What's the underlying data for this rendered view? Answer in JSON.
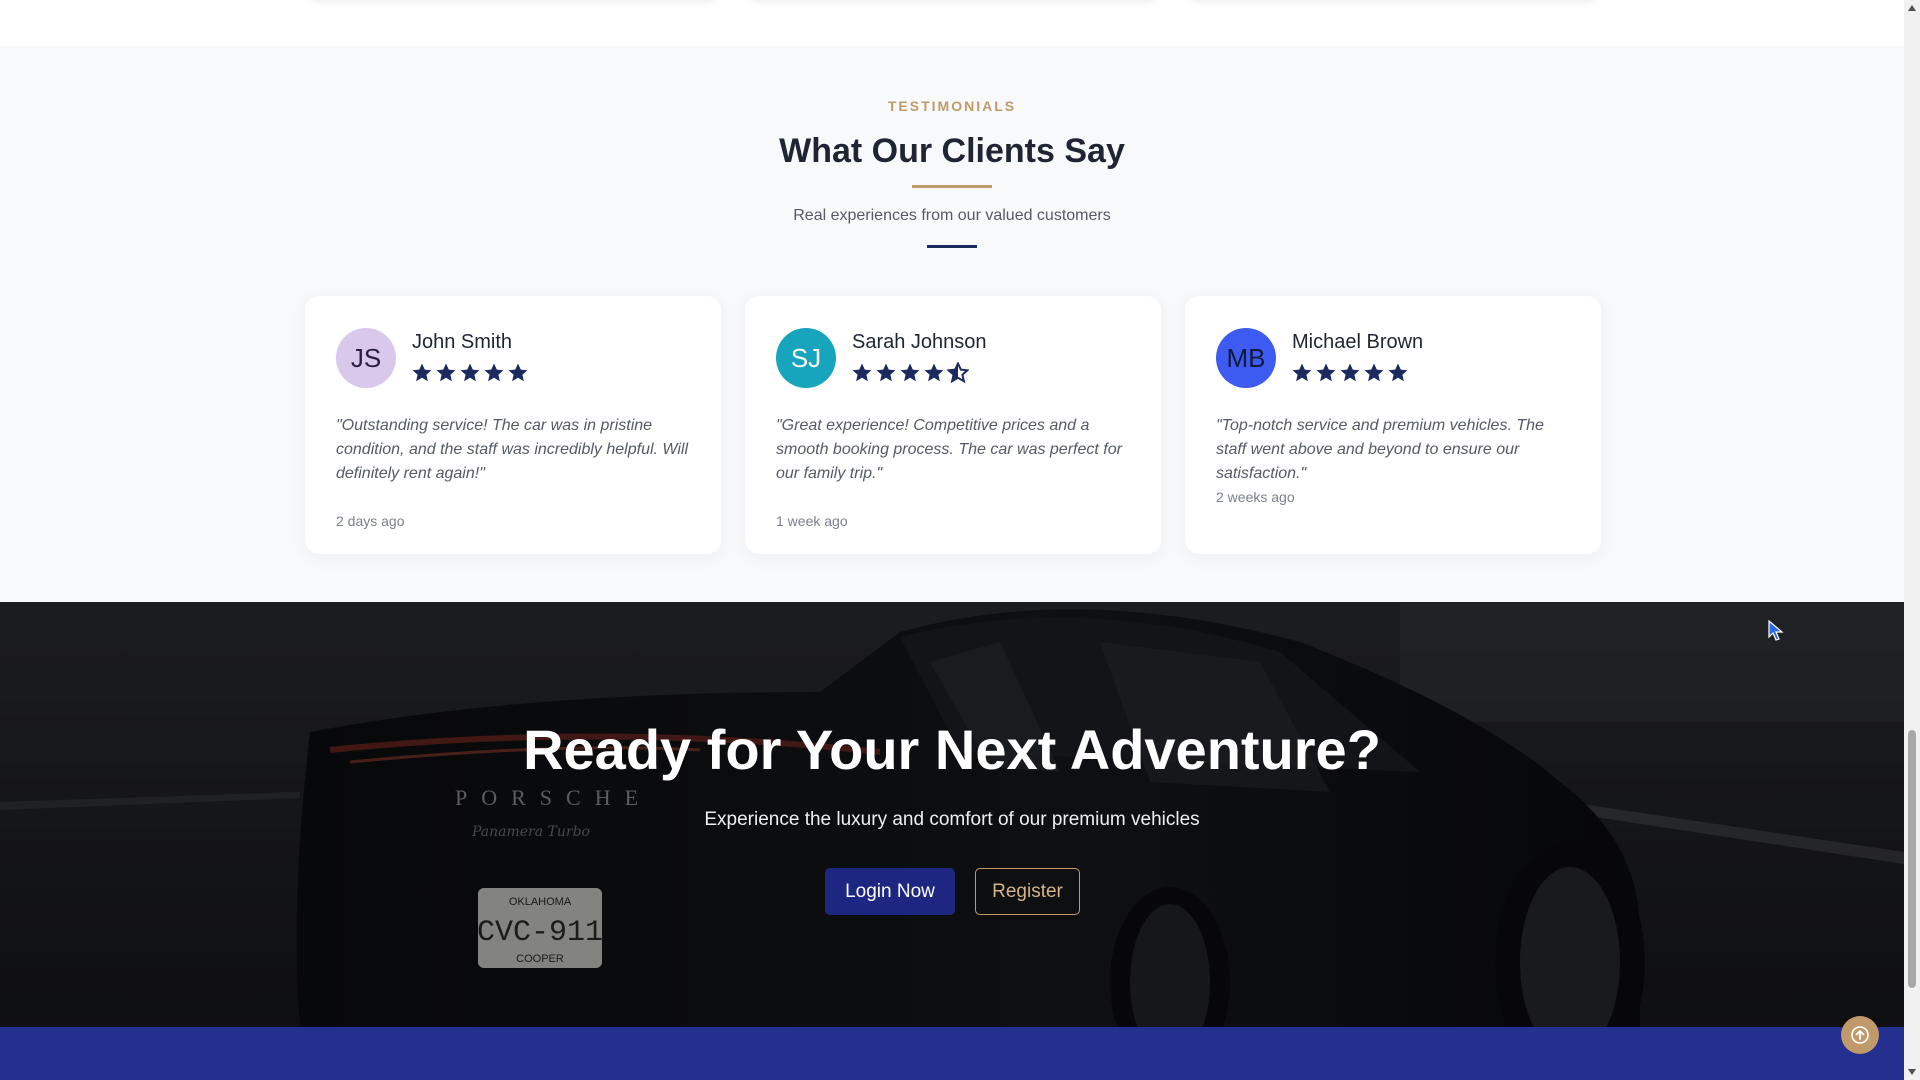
{
  "testimonials": {
    "eyebrow": "TESTIMONIALS",
    "title": "What Our Clients Say",
    "subtitle": "Real experiences from our valued customers",
    "cards": [
      {
        "initials": "JS",
        "name": "John Smith",
        "rating": 5,
        "quote": "\"Outstanding service! The car was in pristine condition, and the staff was incredibly helpful. Will definitely rent again!\"",
        "time": "2 days ago",
        "avatar_bg": "#d9c8ec",
        "avatar_fg": "#2a2040"
      },
      {
        "initials": "SJ",
        "name": "Sarah Johnson",
        "rating": 4.5,
        "quote": "\"Great experience! Competitive prices and a smooth booking process. The car was perfect for our family trip.\"",
        "time": "1 week ago",
        "avatar_bg": "#17a5bd",
        "avatar_fg": "#ffffff"
      },
      {
        "initials": "MB",
        "name": "Michael Brown",
        "rating": 5,
        "quote": "\"Top-notch service and premium vehicles. The staff went above and beyond to ensure our satisfaction.\"",
        "time": "2 weeks ago",
        "avatar_bg": "#3d5af1",
        "avatar_fg": "#111a3a"
      }
    ]
  },
  "cta": {
    "title": "Ready for Your Next Adventure?",
    "subtitle": "Experience the luxury and comfort of our premium vehicles",
    "login_label": "Login Now",
    "register_label": "Register",
    "car_brand": "PORSCHE",
    "car_model": "Panamera Turbo",
    "plate_state": "OKLAHOMA",
    "plate_number": "CVC-911",
    "plate_dealer": "COOPER"
  },
  "colors": {
    "accent_gold": "#c19a6b",
    "navy": "#1b2a5e",
    "star": "#1b2a5e",
    "footer": "#24308f"
  },
  "icons": {
    "star": "star-icon",
    "half_star": "star-half-icon",
    "scroll_top": "arrow-up-icon"
  }
}
